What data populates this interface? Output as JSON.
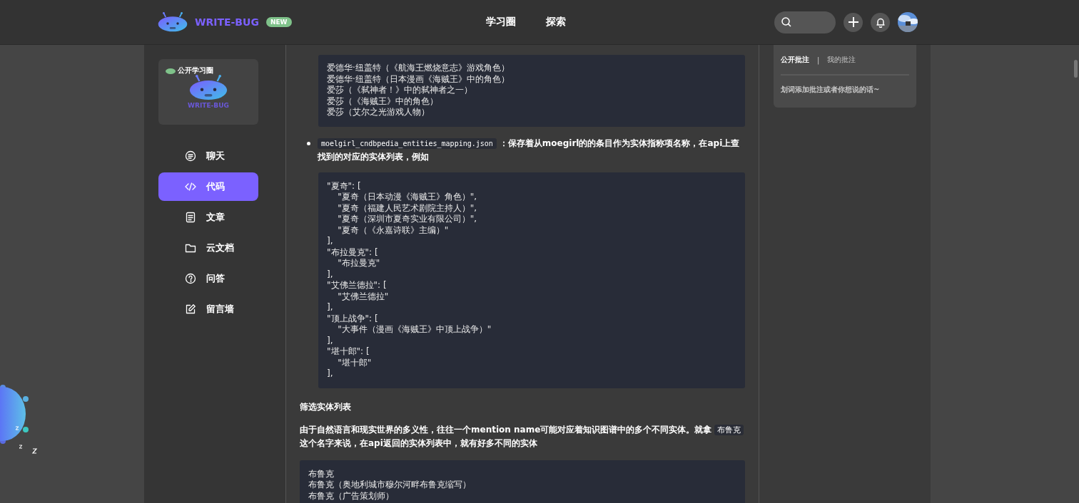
{
  "header": {
    "logo_text": "WRITE-BUG",
    "badge": "NEW",
    "nav": [
      {
        "label": "学习圈",
        "selected": false
      },
      {
        "label": "探索",
        "selected": false
      }
    ]
  },
  "sidebar": {
    "card": {
      "tag": "公开学习圈",
      "title": "WRITE-BUG"
    },
    "items": [
      {
        "label": "聊天",
        "kind": "chat",
        "selected": false
      },
      {
        "label": "代码",
        "kind": "code",
        "selected": true
      },
      {
        "label": "文章",
        "kind": "doc",
        "selected": false
      },
      {
        "label": "云文档",
        "kind": "folder",
        "selected": false
      },
      {
        "label": "问答",
        "kind": "question",
        "selected": false
      },
      {
        "label": "留言墙",
        "kind": "edit",
        "selected": false
      }
    ]
  },
  "article": [
    {
      "kind": "code",
      "lines": [
        "爱德华·纽盖特（《航海王燃烧意志》游戏角色）",
        "爱德华·纽盖特（日本漫画《海贼王》中的角色）",
        "爱莎（《弑神者！》中的弑神者之一）",
        "爱莎（《海贼王》中的角色）",
        "爱莎（艾尔之光游戏人物）"
      ]
    },
    {
      "kind": "bullet",
      "code": "moelgirl_cndbpedia_entities_mapping.json",
      "text": "：保存着从moegirl的的条目作为实体指称项名称，在api上查找到的对应的实体列表，例如"
    },
    {
      "kind": "code",
      "lines": [
        "\"夏奇\": [",
        "    \"夏奇（日本动漫《海贼王》角色）\",",
        "    \"夏奇（福建人民艺术剧院主持人）\",",
        "    \"夏奇（深圳市夏奇实业有限公司）\",",
        "    \"夏奇（《永嘉诗联》主编）\"",
        "],",
        "\"布拉曼克\": [",
        "    \"布拉曼克\"",
        "],",
        "\"艾佛兰德拉\": [",
        "    \"艾佛兰德拉\"",
        "],",
        "\"顶上战争\": [",
        "    \"大事件（漫画《海贼王》中顶上战争）\"",
        "],",
        "\"堪十郎\": [",
        "    \"堪十郎\"",
        "],"
      ]
    },
    {
      "kind": "heading",
      "text": "筛选实体列表"
    },
    {
      "kind": "paragraph",
      "before": "由于自然语言和现实世界的多义性，往往一个mention name可能对应着知识图谱中的多个不同实体。就拿 ",
      "code": "布鲁克",
      "after": " 这个名字来说，在api返回的实体列表中，就有好多不同的实体"
    },
    {
      "kind": "code",
      "lines": [
        "布鲁克",
        "布鲁克（奥地利城市穆尔河畔布鲁克缩写）",
        "布鲁克（广告策划师）"
      ]
    }
  ],
  "annotations": {
    "tabs": [
      {
        "label": "公开批注",
        "selected": true
      },
      {
        "label": "我的批注",
        "selected": false
      }
    ],
    "separator": "|",
    "hint": "划词添加批注或者你想说的话~"
  }
}
